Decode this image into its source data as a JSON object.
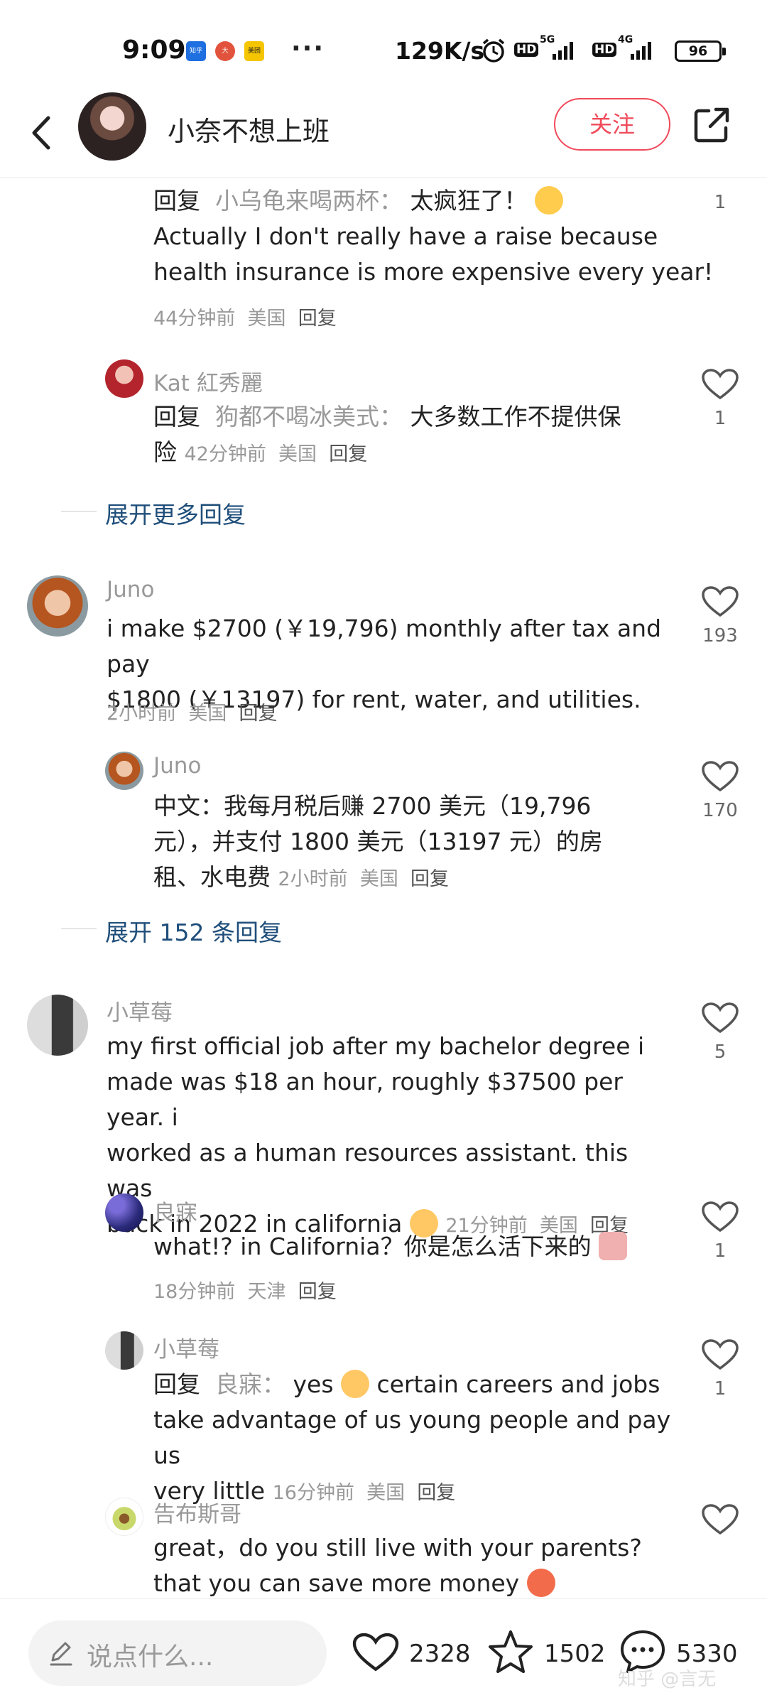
{
  "status_bar": {
    "time": "9:09",
    "network_speed": "129K/s",
    "hd1": "HD",
    "net1": "5G",
    "hd2": "HD",
    "net2": "4G",
    "battery": "96",
    "app_icons": [
      "知乎",
      "大",
      "美团"
    ]
  },
  "header": {
    "title": "小奈不想上班",
    "follow_label": "关注"
  },
  "comments": [
    {
      "type": "reply",
      "prefix": "回复",
      "reply_to": "小乌龟来喝两杯：",
      "text_line1": "太疯狂了！",
      "text_line2": "Actually I don't really have a raise because",
      "text_line3": "health insurance is more expensive every year!",
      "time": "44分钟前",
      "location": "美国",
      "reply_label": "回复",
      "likes": "1"
    },
    {
      "type": "reply",
      "user": "Kat 紅秀麗",
      "prefix": "回复",
      "reply_to": "狗都不喝冰美式：",
      "text_line1": "大多数工作不提供保",
      "text_line2": "险",
      "time": "42分钟前",
      "location": "美国",
      "reply_label": "回复",
      "likes": "1"
    },
    {
      "type": "expand",
      "label": "展开更多回复"
    },
    {
      "type": "top",
      "user": "Juno",
      "text_line1": "i make $2700 (￥19,796) monthly after tax and pay",
      "text_line2": "$1800 (￥13197) for rent, water, and utilities.",
      "time": "2小时前",
      "location": "美国",
      "reply_label": "回复",
      "likes": "193"
    },
    {
      "type": "reply",
      "user": "Juno",
      "text_line1": "中文：我每月税后赚 2700 美元（19,796",
      "text_line2": "元），并支付 1800 美元（13197 元）的房",
      "text_line3": "租、水电费",
      "time": "2小时前",
      "location": "美国",
      "reply_label": "回复",
      "likes": "170"
    },
    {
      "type": "expand",
      "label": "展开 152 条回复"
    },
    {
      "type": "top",
      "user": "小草莓",
      "text_line1": "my first official job after my bachelor degree i",
      "text_line2": "made was $18 an hour, roughly $37500 per year. i",
      "text_line3": "worked as a human resources assistant. this was",
      "text_line4": "back in 2022 in california",
      "time": "21分钟前",
      "location": "美国",
      "reply_label": "回复",
      "likes": "5"
    },
    {
      "type": "reply",
      "user": "良寐",
      "text_line1": "what!? in California？你是怎么活下来的",
      "time": "18分钟前",
      "location": "天津",
      "reply_label": "回复",
      "likes": "1"
    },
    {
      "type": "reply",
      "user": "小草莓",
      "prefix": "回复",
      "reply_to": "良寐：",
      "text_line1": "yes",
      "text_line1b": "certain careers and jobs",
      "text_line2": "take advantage of us young people and pay us",
      "text_line3": "very little",
      "time": "16分钟前",
      "location": "美国",
      "reply_label": "回复",
      "likes": "1"
    },
    {
      "type": "reply",
      "user": "告布斯哥",
      "text_line1": "great，do you still live with your parents?",
      "text_line2": "that you can save more money"
    }
  ],
  "bottom_bar": {
    "input_placeholder": "说点什么...",
    "likes": "2328",
    "favorites": "1502",
    "comments": "5330",
    "watermark": "知乎 @言无"
  },
  "icons": [
    "back-arrow-icon",
    "share-icon",
    "heart-icon",
    "star-icon",
    "comment-icon",
    "pen-icon"
  ]
}
